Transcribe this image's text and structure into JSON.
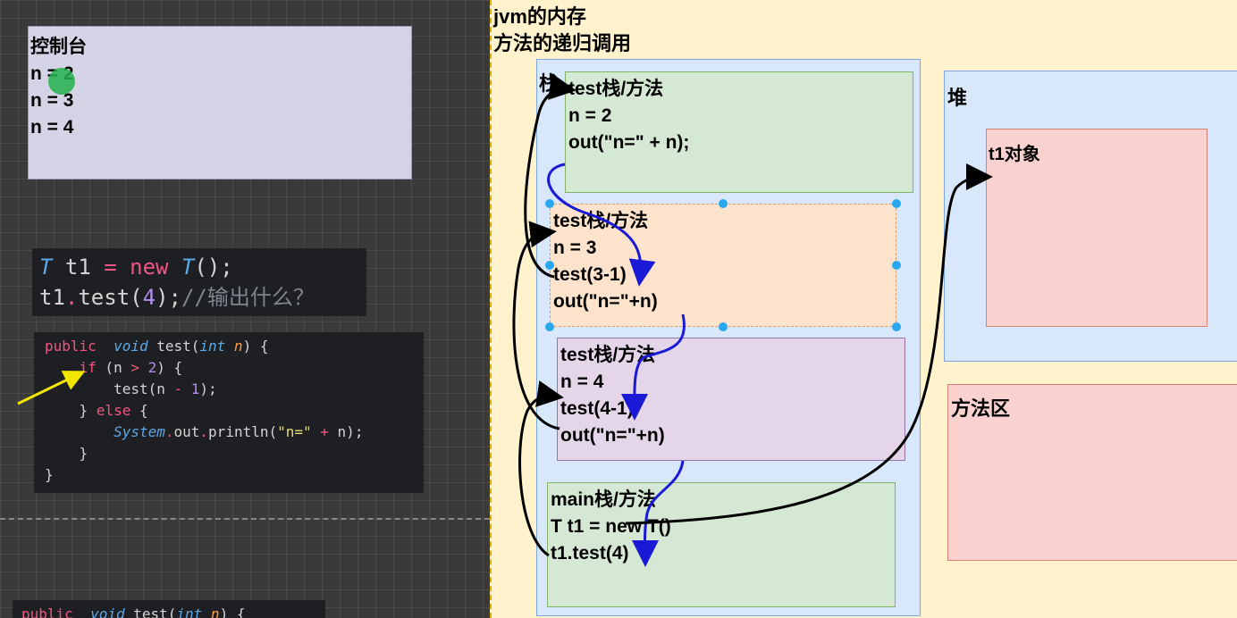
{
  "console": {
    "title": "控制台",
    "lines": [
      "n = 2",
      "n = 3",
      "n = 4"
    ]
  },
  "code_snippet1": {
    "line1": {
      "type": "T",
      "var": " t1 ",
      "eq": "=",
      "new": " new ",
      "type2": "T",
      "rest": "();"
    },
    "line2": {
      "obj": "t1",
      "dot": ".",
      "call": "test(",
      "arg": "4",
      "close": ");",
      "comment": "//输出什么？"
    }
  },
  "code_snippet2": {
    "l1": {
      "kw": "public",
      "void": "void",
      "name": " test(",
      "ptype": "int",
      "pname": " n",
      "end": ") {"
    },
    "l2": {
      "if": "if",
      "cond1": " (n ",
      "gt": ">",
      "num": " 2",
      "cond2": ") {"
    },
    "l3": {
      "call": "test(n ",
      "minus": "-",
      "num": " 1",
      "end": ");"
    },
    "l4": {
      "brace": "} ",
      "else": "else",
      "end": " {"
    },
    "l5": {
      "sys": "System",
      "dot": ".",
      "out": "out",
      "dot2": ".",
      "println": "println(",
      "str": "\"n=\"",
      "plus": " + ",
      "n": "n);"
    },
    "l6": "}",
    "l7": "}"
  },
  "code_snippet3": {
    "kw": "public",
    "void": "void",
    "name": " test(",
    "ptype": "int",
    "pname": " n",
    "end": ") {"
  },
  "diagram": {
    "title_line1": "jvm的内存",
    "title_line2": "方法的递归调用",
    "stack_label": "栈",
    "heap_label": "堆",
    "method_area_label": "方法区",
    "t1_object_label": "t1对象",
    "frames": [
      {
        "lines": [
          "test栈/方法",
          "n = 2",
          "out(\"n=\" + n);"
        ]
      },
      {
        "lines": [
          "test栈/方法",
          "n = 3",
          "test(3-1)",
          "out(\"n=\"+n)"
        ]
      },
      {
        "lines": [
          "test栈/方法",
          "n = 4",
          "test(4-1)",
          "out(\"n=\"+n)"
        ]
      },
      {
        "lines": [
          "main栈/方法",
          "T t1 = new T()",
          "t1.test(4)"
        ]
      }
    ]
  },
  "colors": {
    "stack_bg": "#d9e7fb",
    "green_frame": "#d5e8d4",
    "orange_frame": "#fde3cb",
    "purple_frame": "#e4d6e8",
    "red_box": "#f9d2cf",
    "blue_arrow": "#1a1ad6",
    "black_arrow": "#000000",
    "yellow_pointer": "#f2e600"
  }
}
